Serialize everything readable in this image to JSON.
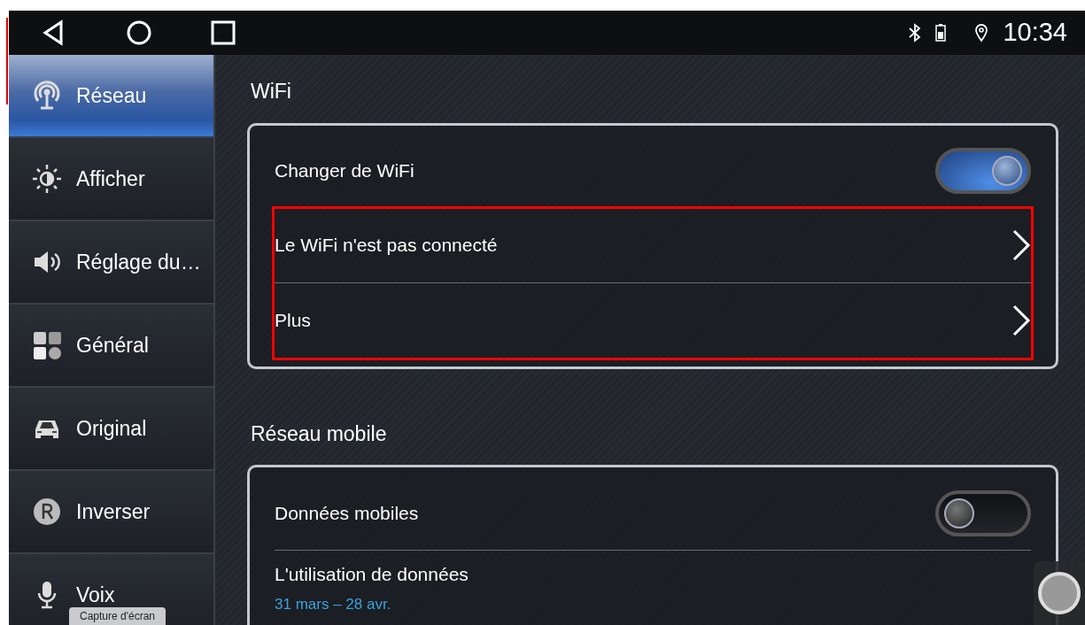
{
  "status_bar": {
    "nav_buttons": [
      {
        "kind": "back"
      },
      {
        "kind": "home"
      },
      {
        "kind": "recents"
      }
    ],
    "time": "10:34"
  },
  "sidebar": {
    "items": [
      {
        "label": "Réseau",
        "kind": "network",
        "selected": true
      },
      {
        "label": "Afficher",
        "kind": "display",
        "selected": false
      },
      {
        "label": "Réglage du…",
        "kind": "sound",
        "selected": false
      },
      {
        "label": "Général",
        "kind": "general",
        "selected": false
      },
      {
        "label": "Original",
        "kind": "car",
        "selected": false
      },
      {
        "label": "Inverser",
        "kind": "reverse",
        "selected": false
      },
      {
        "label": "Voix",
        "kind": "voice",
        "selected": false
      }
    ]
  },
  "sections": [
    {
      "title": "WiFi",
      "rows": [
        {
          "kind": "toggle",
          "label": "Changer de WiFi",
          "on": true,
          "highlighted": false
        },
        {
          "kind": "link",
          "label": "Le WiFi n'est pas connecté",
          "highlighted": true
        },
        {
          "kind": "link",
          "label": "Plus",
          "highlighted": true
        }
      ]
    },
    {
      "title": "Réseau mobile",
      "rows": [
        {
          "kind": "toggle",
          "label": "Données mobiles",
          "on": false,
          "highlighted": false
        },
        {
          "kind": "usage",
          "label": "L'utilisation de données",
          "subtitle": "31 mars – 28 avr.",
          "highlighted": false
        }
      ]
    }
  ],
  "toast": "Capture d'écran"
}
